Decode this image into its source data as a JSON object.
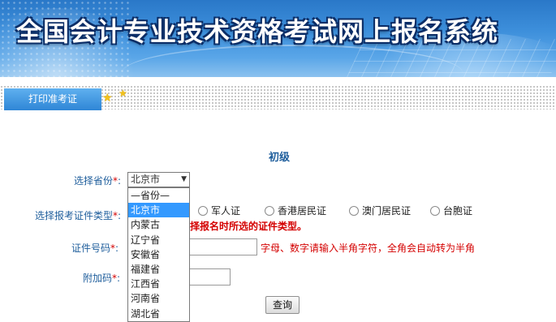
{
  "banner": {
    "title": "全国会计专业技术资格考试网上报名系统"
  },
  "tabs": [
    {
      "label": "打印准考证"
    }
  ],
  "level": "初级",
  "form": {
    "province": {
      "label": "选择省份",
      "required_mark": "*",
      "colon": ":",
      "selected": "北京市",
      "options": [
        "—省份—",
        "北京市",
        "内蒙古",
        "辽宁省",
        "安徽省",
        "福建省",
        "江西省",
        "河南省",
        "湖北省"
      ]
    },
    "id_type": {
      "label": "选择报考证件类型",
      "required_mark": "*",
      "colon": ":",
      "options": [
        "军人证",
        "香港居民证",
        "澳门居民证",
        "台胞证"
      ],
      "warning": "择报名时所选的证件类型。"
    },
    "id_number": {
      "label": "证件号码",
      "required_mark": "*",
      "colon": ":",
      "hint": "字母、数字请输入半角字符，全角会自动转为半角"
    },
    "captcha": {
      "label": "附加码",
      "required_mark": "*",
      "colon": ":"
    },
    "query_button": "查询"
  },
  "colors": {
    "label": "#1f5e9c",
    "required": "#d40000",
    "selected_option_bg": "#3399ff",
    "tab_bg": "#2f86d6"
  }
}
